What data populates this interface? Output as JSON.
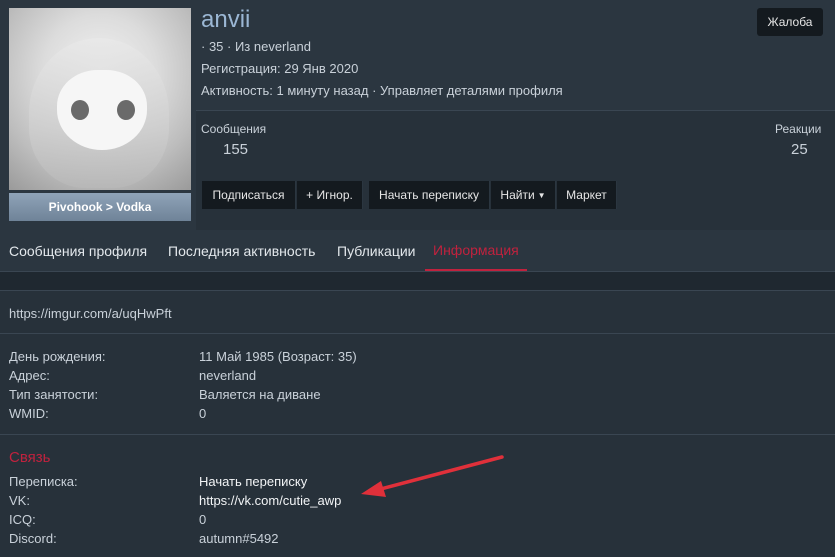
{
  "profile": {
    "username": "anvii",
    "info_line1": "· 35 · Из neverland",
    "registration": "Регистрация: 29 Янв 2020",
    "activity": "Активность: 1 минуту назад · Управляет деталями профиля",
    "avatar_caption": "Pivohook > Vodka",
    "report_label": "Жалоба"
  },
  "stats": {
    "messages_label": "Сообщения",
    "messages_value": "155",
    "reactions_label": "Реакции",
    "reactions_value": "25"
  },
  "actions": {
    "subscribe": "Подписаться",
    "ignore": "+ Игнор.",
    "start_conversation": "Начать переписку",
    "find": "Найти",
    "market": "Маркет"
  },
  "tabs": [
    {
      "label": "Сообщения профиля"
    },
    {
      "label": "Последняя активность"
    },
    {
      "label": "Публикации"
    },
    {
      "label": "Информация"
    }
  ],
  "about": {
    "link": "https://imgur.com/a/uqHwPft"
  },
  "details": [
    {
      "label": "День рождения:",
      "value": "11 Май 1985 (Возраст: 35)"
    },
    {
      "label": "Адрес:",
      "value": "neverland"
    },
    {
      "label": "Тип занятости:",
      "value": "Валяется на диване"
    },
    {
      "label": "WMID:",
      "value": "0"
    }
  ],
  "contact": {
    "title": "Связь",
    "rows": [
      {
        "label": "Переписка:",
        "value": "Начать переписку"
      },
      {
        "label": "VK:",
        "value": "https://vk.com/cutie_awp"
      },
      {
        "label": "ICQ:",
        "value": "0"
      },
      {
        "label": "Discord:",
        "value": "autumn#5492"
      }
    ]
  },
  "colors": {
    "accent": "#c0223e",
    "username": "#9bb7d4",
    "annotation_arrow": "#e0303a"
  }
}
